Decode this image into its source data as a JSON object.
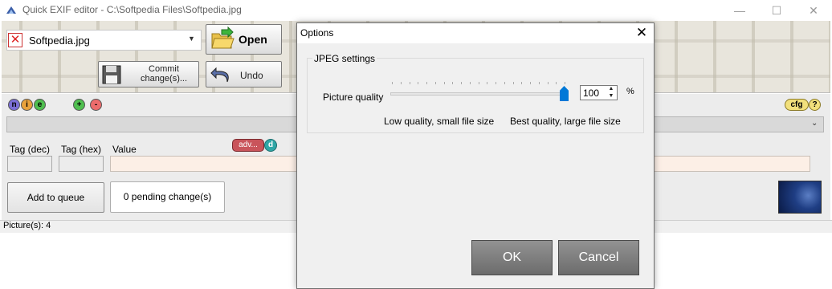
{
  "window": {
    "title": "Quick EXIF editor - C:\\Softpedia Files\\Softpedia.jpg",
    "minimize": "—",
    "maximize": "☐",
    "close": "✕"
  },
  "toolbar": {
    "remove_icon": "✕",
    "file_name": "Softpedia.jpg",
    "file_dropdown_arrow": "▼",
    "open_label": "Open",
    "commit_label": "Commit change(s)...",
    "undo_label": "Undo"
  },
  "panel": {
    "mode_buttons": [
      "n",
      "i",
      "e"
    ],
    "mode_colors": [
      "#7b6fd6",
      "#e9a23b",
      "#4fbf4f"
    ],
    "add_label": "+",
    "remove_label": "-",
    "cfg_label": "cfg",
    "help_label": "?",
    "dropdown_arrow": "⌄",
    "tag_dec_label": "Tag (dec)",
    "tag_hex_label": "Tag (hex)",
    "value_label": "Value",
    "adv_label": "adv...",
    "d_label": "d",
    "queue_label": "Add to queue",
    "pending_label": "0 pending change(s)"
  },
  "status": {
    "pictures": "Picture(s): 4"
  },
  "dialog": {
    "title": "Options",
    "close": "✕",
    "group_title": "JPEG settings",
    "quality_label": "Picture quality",
    "quality_value": "100",
    "quality_percent": 100,
    "percent_sign": "%",
    "spin_up": "▲",
    "spin_down": "▼",
    "low_label": "Low quality, small file size",
    "best_label": "Best quality, large file size",
    "ok_label": "OK",
    "cancel_label": "Cancel"
  },
  "colors": {
    "accent": "#0078d7",
    "adv_button": "#c9545b",
    "cfg_button": "#f2e07c",
    "dialog_button": "#7d7d7d"
  }
}
